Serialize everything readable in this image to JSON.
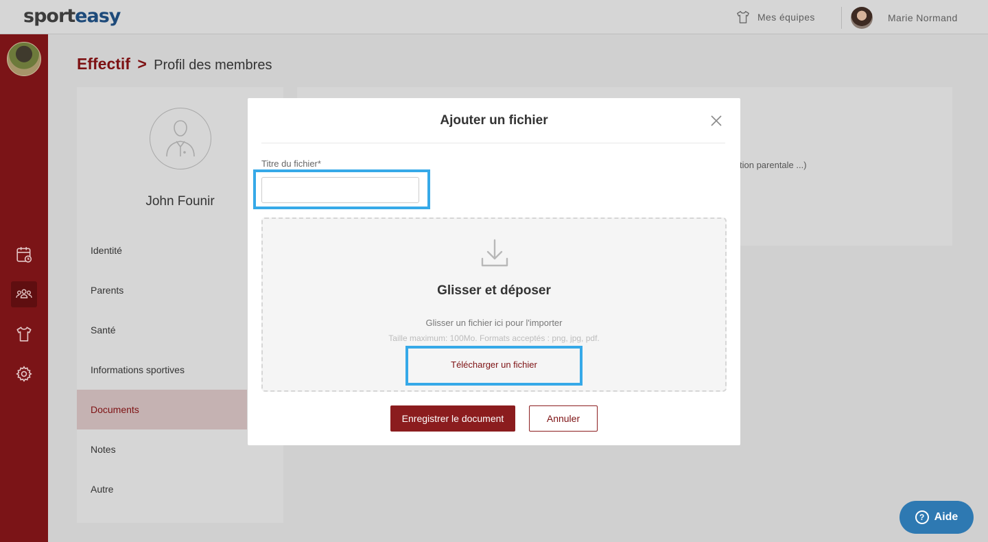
{
  "header": {
    "logo_part1": "sport",
    "logo_part2": "easy",
    "my_teams_label": "Mes équipes",
    "user_name": "Marie Normand"
  },
  "sidebar": {
    "icons": [
      "calendar-icon",
      "team-members-icon",
      "jersey-icon",
      "settings-icon"
    ],
    "active_icon": "team-members-icon"
  },
  "breadcrumb": {
    "root": "Effectif",
    "separator": ">",
    "current": "Profil des membres"
  },
  "profile": {
    "name": "John Founir",
    "menu": [
      {
        "label": "Identité"
      },
      {
        "label": "Parents"
      },
      {
        "label": "Santé"
      },
      {
        "label": "Informations sportives"
      },
      {
        "label": "Documents"
      },
      {
        "label": "Notes"
      },
      {
        "label": "Autre"
      }
    ],
    "active_menu_item": "Documents"
  },
  "background_panel": {
    "peek_text": "tion parentale ...)"
  },
  "modal": {
    "title": "Ajouter un fichier",
    "title_field_label": "Titre du fichier*",
    "title_field_value": "",
    "dropzone": {
      "heading": "Glisser et déposer",
      "subtitle": "Glisser un fichier ici pour l'importer",
      "hint": "Taille maximum: 100Mo. Formats acceptés : png, jpg, pdf.",
      "upload_link": "Télécharger un fichier"
    },
    "save_button": "Enregistrer le document",
    "cancel_button": "Annuler"
  },
  "help": {
    "label": "Aide"
  },
  "colors": {
    "brand": "#7b1417",
    "primary_button": "#8b1c1e",
    "highlight": "#36a9e8",
    "help_button": "#2e79b2"
  }
}
